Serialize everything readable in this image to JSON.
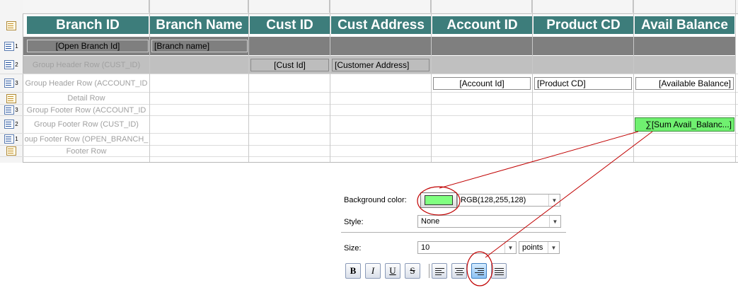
{
  "columns": [
    "Branch ID",
    "Branch Name",
    "Cust ID",
    "Cust Address",
    "Account ID",
    "Product CD",
    "Avail Balance"
  ],
  "rows": [
    {
      "num": "1",
      "label": ""
    },
    {
      "num": "2",
      "label": "Group Header Row (CUST_ID)"
    },
    {
      "num": "3",
      "label": "Group Header Row (ACCOUNT_ID"
    },
    {
      "num": "",
      "label": "Detail Row"
    },
    {
      "num": "3",
      "label": "Group Footer Row (ACCOUNT_ID"
    },
    {
      "num": "2",
      "label": "Group Footer Row (CUST_ID)"
    },
    {
      "num": "1",
      "label": "oup Footer Row (OPEN_BRANCH_"
    },
    {
      "num": "",
      "label": "Footer Row"
    }
  ],
  "fields": {
    "open_branch_id": "[Open Branch Id]",
    "branch_name": "[Branch name]",
    "cust_id": "[Cust Id]",
    "customer_address": "[Customer Address]",
    "account_id": "[Account Id]",
    "product_cd": "[Product CD]",
    "available_balance": "[Available Balance]",
    "sum_avail_balance": "∑[Sum Avail_Balanc...]"
  },
  "panel": {
    "background_color_label": "Background color:",
    "background_color_value": "RGB(128,255,128)",
    "style_label": "Style:",
    "style_value": "None",
    "size_label": "Size:",
    "size_value": "10",
    "size_unit": "points",
    "bold_label": "B",
    "italic_label": "I",
    "underline_label": "U",
    "strike_label": "S"
  },
  "colors": {
    "header_bg": "#3d7d7b",
    "selected_bg": "#80ff80",
    "annotation": "#c00000"
  }
}
